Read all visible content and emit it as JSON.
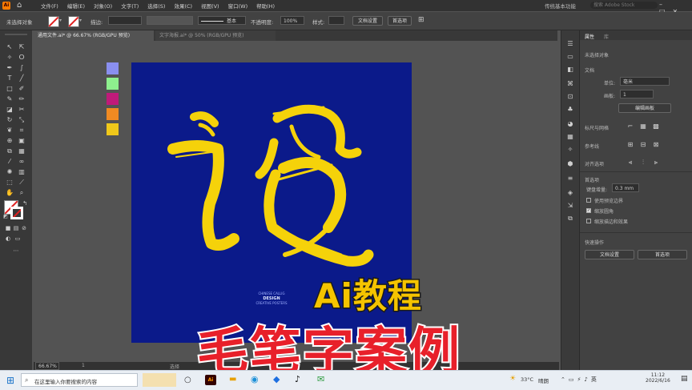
{
  "app": {
    "logo": "Ai",
    "menus": [
      "文件(F)",
      "编辑(E)",
      "对象(O)",
      "文字(T)",
      "选择(S)",
      "效果(C)",
      "视图(V)",
      "窗口(W)",
      "帮助(H)"
    ],
    "workspace": "传统基本功能",
    "search_placeholder": "搜索 Adobe Stock"
  },
  "control_bar": {
    "selection_label": "未选择对象",
    "stroke_label": "描边:",
    "stroke_profile": "基本",
    "opacity_label": "不透明度:",
    "opacity_value": "100%",
    "style_label": "样式:",
    "doc_setup_button": "文档设置",
    "prefs_button": "首选项"
  },
  "tabs": [
    {
      "label": "通用文件.ai* @ 66.67% (RGB/GPU 预览)",
      "active": true
    },
    {
      "label": "文字海报.ai* @ 50% (RGB/GPU 预览)",
      "active": false
    }
  ],
  "swatch_colors": [
    "#8a8ff0",
    "#8ef08e",
    "#c01a7a",
    "#f08a22",
    "#f0c81a"
  ],
  "artboard": {
    "background": "#0b1a8a",
    "brush_color": "#f5d20a",
    "caption": [
      "CHINESE CALLIG",
      "DESIGN",
      "CREATIVE POSTERS"
    ]
  },
  "properties_panel": {
    "tabs": [
      "属性",
      "库"
    ],
    "no_selection": "未选择对象",
    "doc_section": "文档",
    "unit_label": "单位:",
    "unit_value": "毫米",
    "artboard_label": "画板:",
    "artboard_value": "1",
    "edit_artboard_button": "编辑画板",
    "ruler_grid": "标尺与网格",
    "guides": "参考线",
    "align": "对齐选项",
    "prefs_section": "首选项",
    "keyboard_inc_label": "键盘增量:",
    "keyboard_inc_value": "0.3 mm",
    "checkbox_preview_bounds": "使用预览边界",
    "checkbox_scale_corners": "缩放圆角",
    "checkbox_scale_strokes": "缩放描边和效果",
    "quick_actions": "快速操作",
    "doc_setup_button": "文档设置",
    "prefs_button": "首选项"
  },
  "status_bar": {
    "zoom": "66.67%",
    "page": "1",
    "tool": "选择"
  },
  "overlay": {
    "subtitle": "Ai教程",
    "title": "毛笔字案例"
  },
  "taskbar": {
    "search_placeholder": "在这里输入你要搜索的内容",
    "temperature": "33°C",
    "weather": "晴朗",
    "time": "11:12",
    "date": "2022/6/16"
  }
}
